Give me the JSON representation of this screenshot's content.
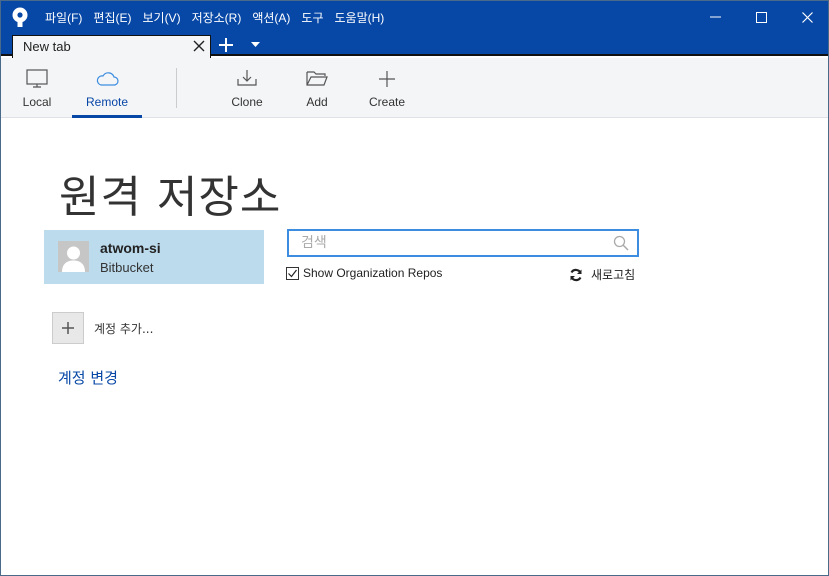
{
  "titlebar": {
    "menu": [
      "파일(F)",
      "편집(E)",
      "보기(V)",
      "저장소(R)",
      "액션(A)",
      "도구",
      "도움말(H)"
    ]
  },
  "tabs": {
    "active_tab_label": "New tab"
  },
  "toolbar": {
    "local_label": "Local",
    "remote_label": "Remote",
    "clone_label": "Clone",
    "add_label": "Add",
    "create_label": "Create",
    "active": "Remote"
  },
  "main": {
    "title": "원격 저장소",
    "account": {
      "name": "atwom-si",
      "service": "Bitbucket"
    },
    "search": {
      "placeholder": "검색",
      "value": ""
    },
    "show_org_repos": {
      "label": "Show Organization Repos",
      "checked": true
    },
    "refresh_label": "새로고침",
    "add_account_label": "계정 추가...",
    "change_account_label": "계정 변경"
  },
  "colors": {
    "brand": "#0747a6",
    "selected_account_bg": "#bcdcee",
    "search_focus_border": "#3c8de0"
  }
}
